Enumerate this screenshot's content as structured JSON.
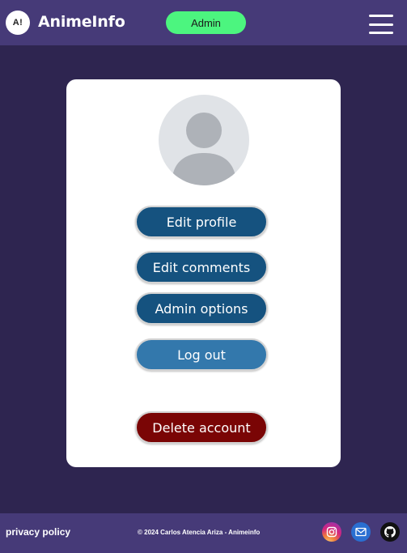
{
  "header": {
    "logo_text": "A!",
    "brand": "AnimeInfo",
    "admin_label": "Admin"
  },
  "profile": {
    "buttons": {
      "edit_profile": "Edit profile",
      "edit_comments": "Edit comments",
      "admin_options": "Admin options",
      "log_out": "Log out",
      "delete_account": "Delete account"
    }
  },
  "footer": {
    "privacy": "privacy policy",
    "copyright": "© 2024 Carlos Atencia Ariza - Animeinfo",
    "social": [
      "instagram-icon",
      "mail-icon",
      "github-icon"
    ]
  },
  "colors": {
    "header_bg": "#463a78",
    "page_bg": "#2e2550",
    "admin_green": "#4cf57f",
    "primary_button": "#15527f",
    "logout_button": "#3378ac",
    "danger_button": "#7a0505"
  }
}
